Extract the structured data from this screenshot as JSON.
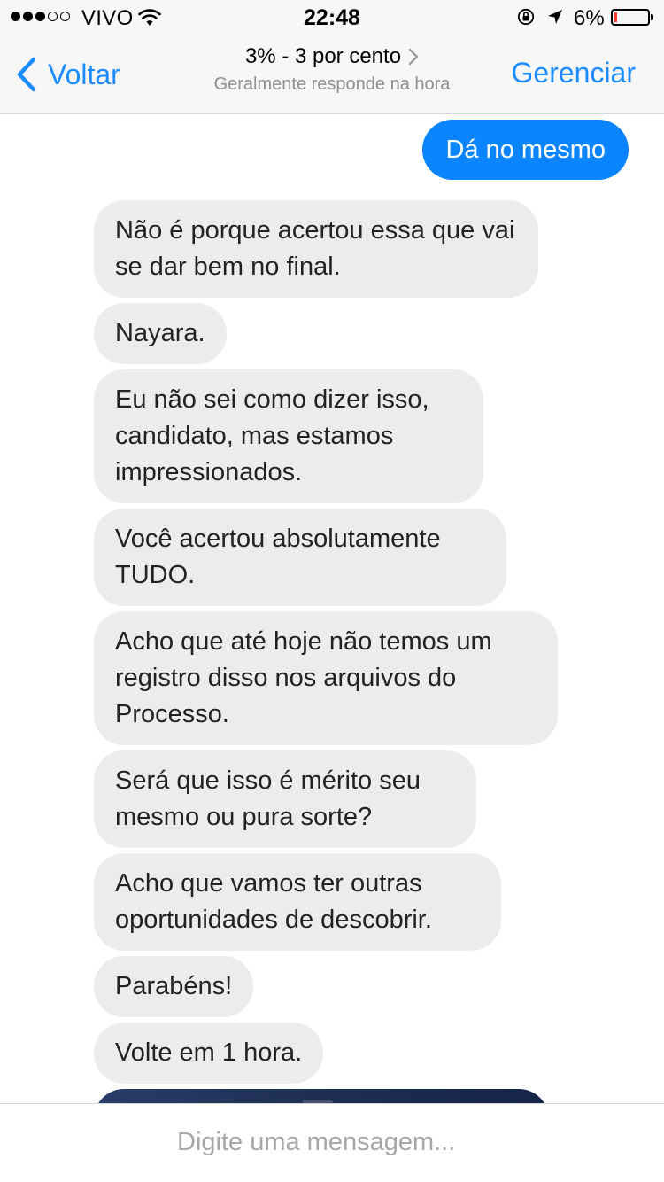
{
  "status_bar": {
    "carrier": "VIVO",
    "signal_bars_filled": 3,
    "signal_bars_total": 5,
    "time": "22:48",
    "battery_percent": "6%",
    "battery_color": "#ff3b30"
  },
  "nav": {
    "back_label": "Voltar",
    "title": "3% - 3 por cento",
    "subtitle": "Geralmente responde na hora",
    "manage_label": "Gerenciar",
    "accent_color": "#1a8cff"
  },
  "messages": {
    "outgoing": "Dá no mesmo",
    "incoming": [
      "Não é porque acertou essa que vai se dar bem no final.",
      "Nayara.",
      "Eu não sei como dizer isso, candidato, mas estamos impressionados.",
      "Você acertou absolutamente TUDO.",
      "Acho que até hoje não temos um registro disso nos arquivos do Processo.",
      "Será que isso é mérito seu mesmo ou pura sorte?",
      "Acho que vamos ter outras oportunidades de descobrir.",
      "Parabéns!",
      "Volte em 1 hora."
    ]
  },
  "composer": {
    "placeholder": "Digite uma mensagem...",
    "value": ""
  }
}
